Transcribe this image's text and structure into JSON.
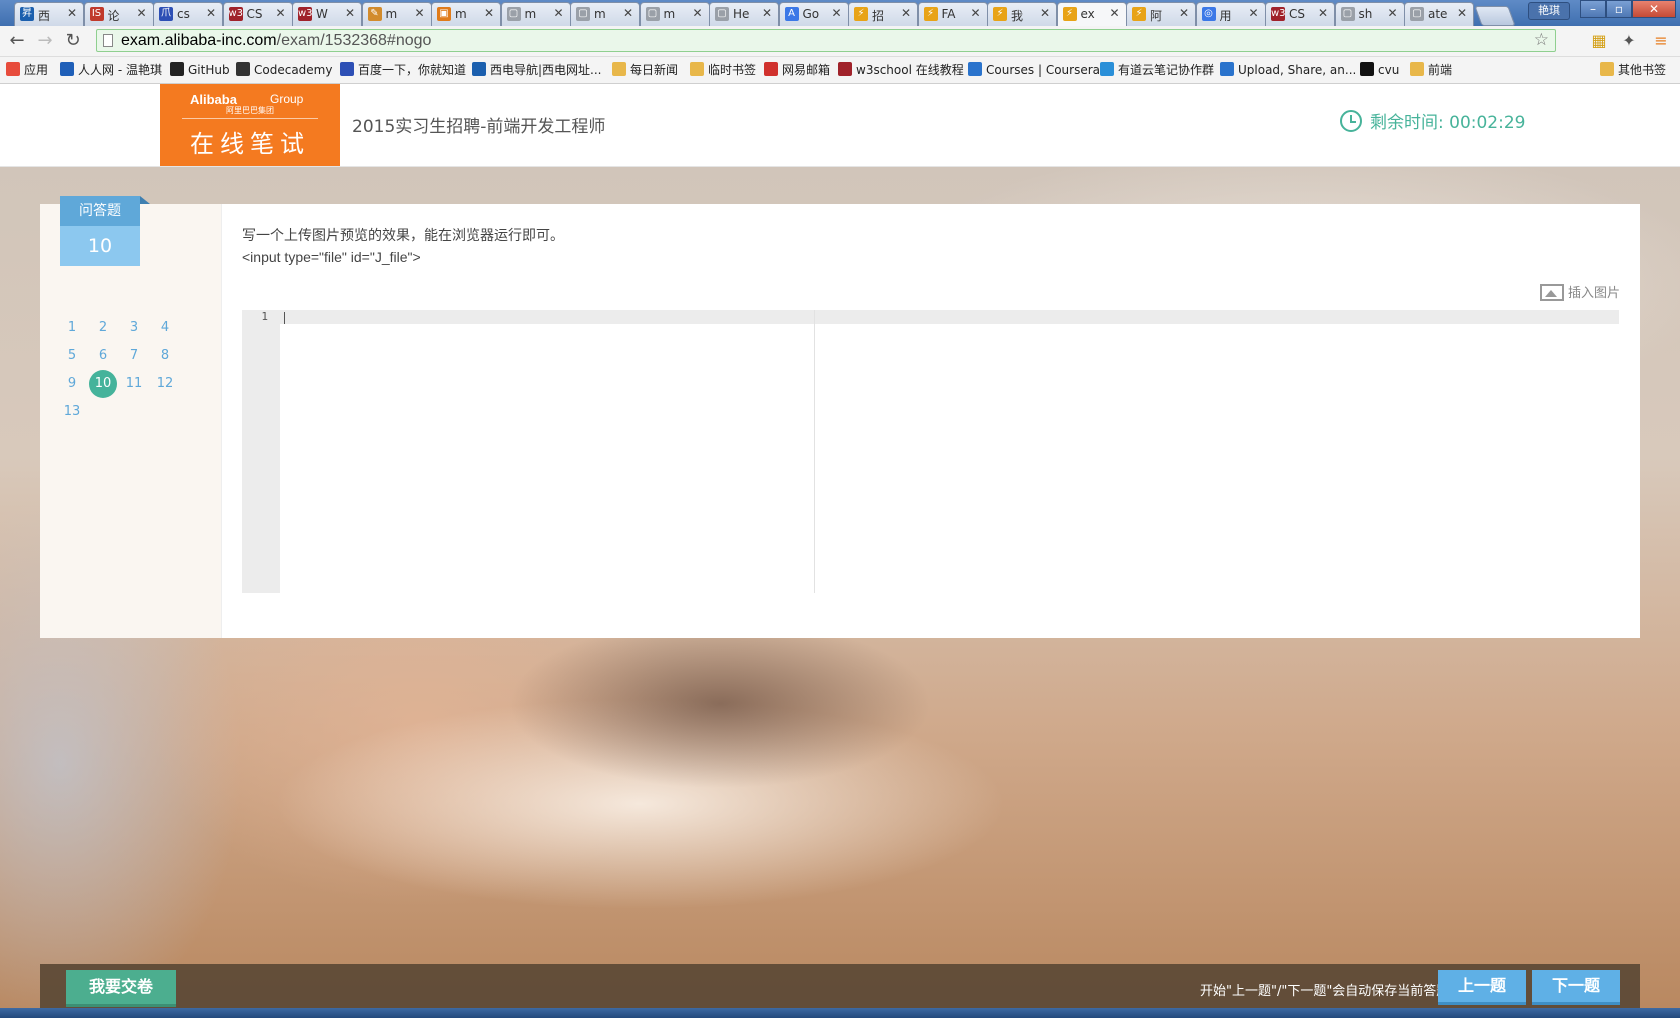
{
  "browser": {
    "tabs": [
      {
        "label": "西",
        "fav": "昇",
        "favColor": "#1b5fae"
      },
      {
        "label": "论",
        "fav": "IS",
        "favColor": "#c0392b"
      },
      {
        "label": "cs",
        "fav": "爪",
        "favColor": "#2d4fb5"
      },
      {
        "label": "CS",
        "fav": "w3",
        "favColor": "#a0222a"
      },
      {
        "label": "W",
        "fav": "w3",
        "favColor": "#a0222a"
      },
      {
        "label": "m",
        "fav": "✎",
        "favColor": "#d28b2c"
      },
      {
        "label": "m",
        "fav": "▣",
        "favColor": "#e07b1a"
      },
      {
        "label": "m",
        "fav": "▢",
        "favColor": "#9aa0a8"
      },
      {
        "label": "m",
        "fav": "▢",
        "favColor": "#9aa0a8"
      },
      {
        "label": "m",
        "fav": "▢",
        "favColor": "#9aa0a8"
      },
      {
        "label": "He",
        "fav": "▢",
        "favColor": "#9aa0a8"
      },
      {
        "label": "Go",
        "fav": "A",
        "favColor": "#3b78e7"
      },
      {
        "label": "招",
        "fav": "⚡",
        "favColor": "#e8a317"
      },
      {
        "label": "FA",
        "fav": "⚡",
        "favColor": "#e8a317"
      },
      {
        "label": "我",
        "fav": "⚡",
        "favColor": "#e8a317"
      },
      {
        "label": "ex",
        "fav": "⚡",
        "favColor": "#e8a317",
        "active": true
      },
      {
        "label": "阿",
        "fav": "⚡",
        "favColor": "#e8a317"
      },
      {
        "label": "用",
        "fav": "◎",
        "favColor": "#3b78e7"
      },
      {
        "label": "CS",
        "fav": "w3",
        "favColor": "#a0222a"
      },
      {
        "label": "sh",
        "fav": "▢",
        "favColor": "#9aa0a8"
      },
      {
        "label": "ate",
        "fav": "▢",
        "favColor": "#9aa0a8"
      }
    ],
    "user": "艳琪",
    "url_host": "exam.alibaba-inc.com",
    "url_path": "/exam/1532368#nogo",
    "bookmarks": [
      {
        "label": "应用",
        "icon": "apps-icon"
      },
      {
        "label": "人人网 - 温艳琪",
        "icon": "renren-icon"
      },
      {
        "label": "GitHub",
        "icon": "github-icon"
      },
      {
        "label": "Codecademy",
        "icon": "codecademy-icon"
      },
      {
        "label": "百度一下，你就知道",
        "icon": "baidu-icon"
      },
      {
        "label": "西电导航|西电网址...",
        "icon": "xidian-icon"
      },
      {
        "label": "每日新闻",
        "icon": "folder-icon"
      },
      {
        "label": "临时书签",
        "icon": "folder-icon"
      },
      {
        "label": "网易邮箱",
        "icon": "netease-icon"
      },
      {
        "label": "w3school 在线教程",
        "icon": "w3school-icon"
      },
      {
        "label": "Courses | Coursera",
        "icon": "coursera-icon"
      },
      {
        "label": "有道云笔记协作群",
        "icon": "youdao-icon"
      },
      {
        "label": "Upload, Share, an...",
        "icon": "upload-icon"
      },
      {
        "label": "cvu",
        "icon": "cvu-icon"
      },
      {
        "label": "前端",
        "icon": "folder-icon"
      },
      {
        "label": "其他书签",
        "icon": "folder-icon"
      }
    ]
  },
  "header": {
    "logo_brand": "Alibaba",
    "logo_group": "Group",
    "logo_brand_cn": "阿里巴巴集团",
    "logo_title": "在线笔试",
    "exam_title": "2015实习生招聘-前端开发工程师",
    "timer_label": "剩余时间: 00:02:29"
  },
  "sidebar": {
    "type_label": "问答题",
    "type_number": "10",
    "questions": [
      "1",
      "2",
      "3",
      "4",
      "5",
      "6",
      "7",
      "8",
      "9",
      "10",
      "11",
      "12",
      "13"
    ],
    "current": "10"
  },
  "question": {
    "text": "写一个上传图片预览的效果，能在浏览器运行即可。",
    "code": "<input type=\"file\" id=\"J_file\">",
    "insert_image_label": "插入图片"
  },
  "editor": {
    "line_number": "1"
  },
  "footer": {
    "submit_label": "我要交卷",
    "hint": "开始\"上一题\"/\"下一题\"会自动保存当前答题",
    "prev_label": "上一题",
    "next_label": "下一题"
  },
  "colors": {
    "brand_orange": "#f47a20",
    "accent_green": "#45b39b",
    "accent_blue": "#5fa8d9"
  }
}
